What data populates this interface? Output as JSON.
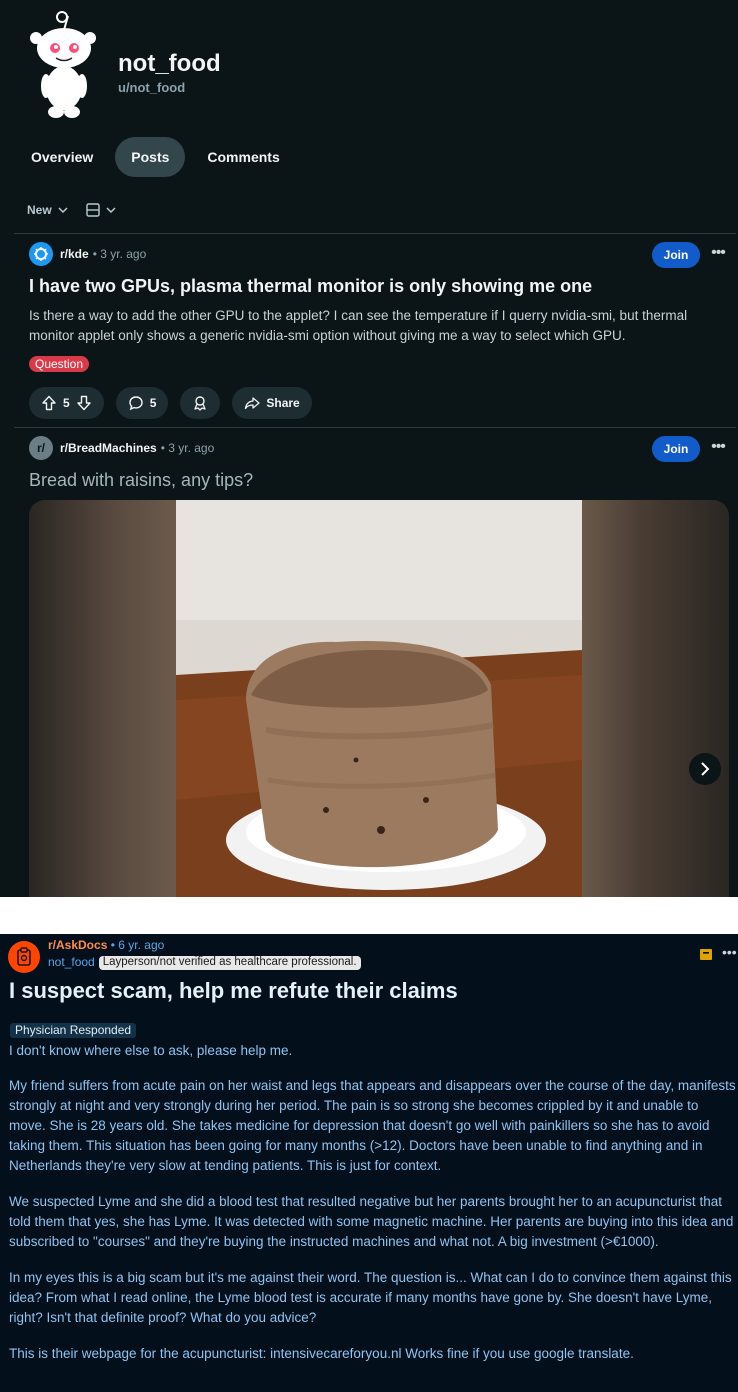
{
  "profile": {
    "display_name": "not_food",
    "handle": "u/not_food"
  },
  "tabs": [
    {
      "label": "Overview",
      "active": false
    },
    {
      "label": "Posts",
      "active": true
    },
    {
      "label": "Comments",
      "active": false
    }
  ],
  "sort": {
    "label": "New"
  },
  "posts": [
    {
      "subreddit": "r/kde",
      "age": "• 3 yr. ago",
      "join_label": "Join",
      "title": "I have two GPUs, plasma thermal monitor is only showing me one",
      "body": "Is there a way to add the other GPU to the applet? I can see the temperature if I querry nvidia-smi, but thermal monitor applet only shows a generic nvidia-smi option without giving me a way to select which GPU.",
      "flair": "Question",
      "votes": "5",
      "comments": "5",
      "share_label": "Share"
    },
    {
      "subreddit": "r/BreadMachines",
      "subreddit_icon_text": "r/",
      "age": "• 3 yr. ago",
      "join_label": "Join",
      "title": "Bread with raisins, any tips?"
    }
  ],
  "askdocs": {
    "subreddit": "r/AskDocs",
    "age": "• 6 yr. ago",
    "user": "not_food",
    "user_flair": "Layperson/not verified as healthcare professional.",
    "title": "I suspect scam, help me refute their claims",
    "post_flair": "Physician Responded",
    "paragraphs": [
      "I don't know where else to ask, please help me.",
      "My friend suffers from acute pain on her waist and legs that appears and disappears over the course of the day, manifests strongly at night and very strongly during her period. The pain is so strong she becomes crippled by it and unable to move. She is 28 years old. She takes medicine for depression that doesn't go well with painkillers so she has to avoid taking them. This situation has been going for many months (>12). Doctors have been unable to find anything and in Netherlands they're very slow at tending patients. This is just for context.",
      "We suspected Lyme and she did a blood test that resulted negative but her parents brought her to an acupuncturist that told them that yes, she has Lyme. It was detected with some magnetic machine. Her parents are buying into this idea and subscribed to \"courses\" and they're buying the instructed machines and what not. A big investment (>€1000).",
      "In my eyes this is a big scam but it's me against their word. The question is... What can I do to convince them against this idea? From what I read online, the Lyme blood test is accurate if many months have gone by. She doesn't have Lyme, right? Isn't that definite proof? What do you advice?",
      "This is their webpage for the acupuncturist: intensivecareforyou.nl Works fine if you use google translate."
    ]
  },
  "colors": {
    "background_top": "#0b1416",
    "background_bottom": "#030f1b",
    "join": "#115bca",
    "flair_question": "#d93a4a",
    "askdocs_orange": "#ff4500"
  },
  "icons": [
    "snoo-avatar-icon",
    "chevron-down-icon",
    "card-layout-icon",
    "kde-logo-icon",
    "upvote-icon",
    "downvote-icon",
    "comment-icon",
    "award-icon",
    "share-icon",
    "more-icon",
    "chevron-right-icon",
    "askdocs-icon",
    "bookmark-icon"
  ]
}
